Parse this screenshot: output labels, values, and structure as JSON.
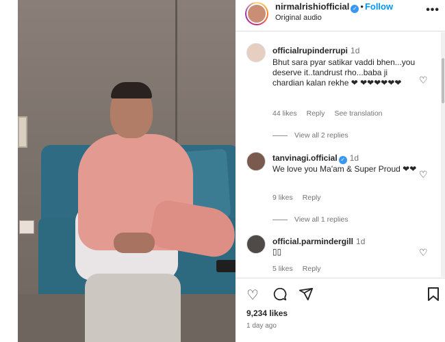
{
  "post": {
    "username": "nirmalrishiofficial",
    "follow_label": "Follow",
    "audio": "Original audio"
  },
  "comments": [
    {
      "username": "officialrupinderrupi",
      "time": "1d",
      "text": "Bhut sara pyar satikar vaddi bhen...you deserve it..tandrust rho...baba ji chardian kalan rekhe ❤ ❤❤❤❤❤❤",
      "likes": "44 likes",
      "reply_label": "Reply",
      "translate_label": "See translation",
      "replies_label": "View all 2 replies"
    },
    {
      "username": "tanvinagi.official",
      "time": "1d",
      "text": "We love you Ma'am & Super Proud ❤❤",
      "likes": "9 likes",
      "reply_label": "Reply",
      "replies_label": "View all 1 replies"
    },
    {
      "username": "official.parmindergill",
      "time": "1d",
      "text": "▯▯",
      "likes": "5 likes",
      "reply_label": "Reply"
    }
  ],
  "footer": {
    "likes": "9,234 likes",
    "time_ago": "1 day ago"
  },
  "icons": {
    "heart": "heart-icon",
    "comment": "comment-icon",
    "share": "share-icon",
    "save": "bookmark-icon",
    "more": "more-icon"
  },
  "colors": {
    "accent": "#0095f6",
    "verified": "#3897f0",
    "muted": "#737373"
  }
}
